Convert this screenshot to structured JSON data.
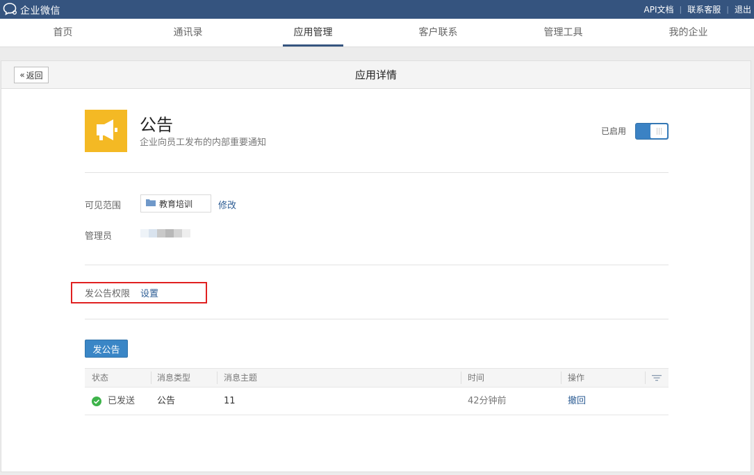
{
  "topbar": {
    "logo_text": "企业微信",
    "links": [
      "API文档",
      "联系客服",
      "退出"
    ]
  },
  "nav": {
    "items": [
      "首页",
      "通讯录",
      "应用管理",
      "客户联系",
      "管理工具",
      "我的企业"
    ],
    "active": "应用管理"
  },
  "panel": {
    "back_label": "返回",
    "title": "应用详情"
  },
  "app": {
    "name": "公告",
    "description": "企业向员工发布的内部重要通知",
    "status_label": "已启用",
    "enabled": true,
    "icon": "megaphone-icon",
    "icon_color": "#f4b924"
  },
  "settings": {
    "scope_label": "可见范围",
    "scope_value": "教育培训",
    "scope_modify": "修改",
    "admin_label": "管理员",
    "permission_label": "发公告权限",
    "permission_link": "设置"
  },
  "publish_button": "发公告",
  "table": {
    "headers": [
      "状态",
      "消息类型",
      "消息主题",
      "时间",
      "操作"
    ],
    "rows": [
      {
        "status": "已发送",
        "type": "公告",
        "subject": "11",
        "time": "42分钟前",
        "action": "撤回"
      }
    ]
  },
  "colors": {
    "topbar": "#35547f",
    "accent": "#3a86c6",
    "link": "#2d5d94",
    "highlight_box": "#e02020",
    "success": "#3db34a"
  }
}
